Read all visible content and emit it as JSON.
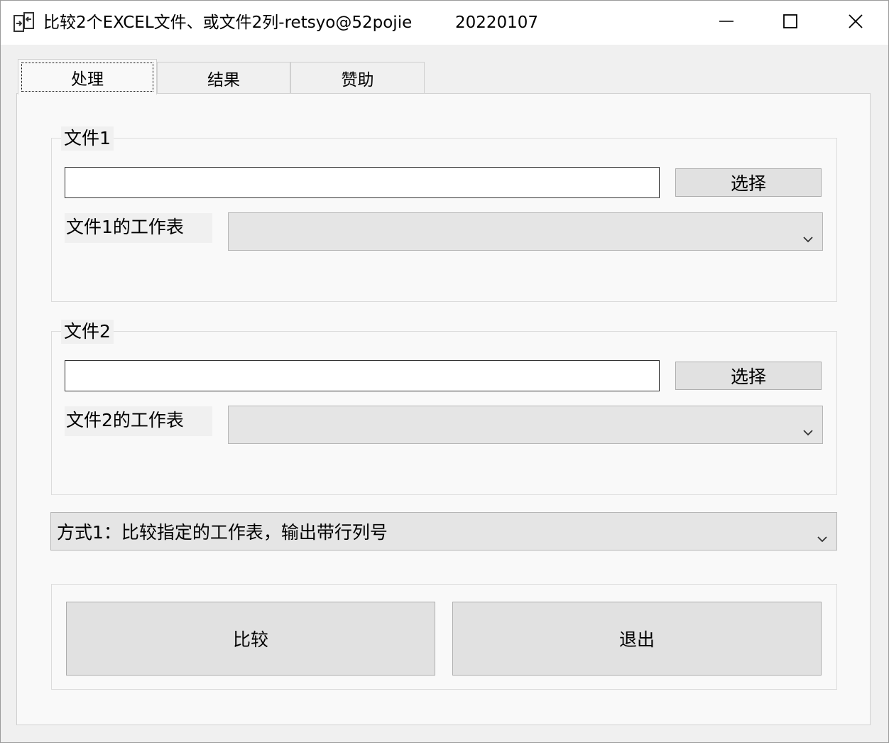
{
  "window": {
    "title": "比较2个EXCEL文件、或文件2列-retsyo@52pojie",
    "version": "20220107"
  },
  "tabs": [
    {
      "label": "处理",
      "active": true
    },
    {
      "label": "结果",
      "active": false
    },
    {
      "label": "赞助",
      "active": false
    }
  ],
  "file1": {
    "legend": "文件1",
    "path_value": "",
    "choose_label": "选择",
    "sheet_label": "文件1的工作表",
    "sheet_selected": ""
  },
  "file2": {
    "legend": "文件2",
    "path_value": "",
    "choose_label": "选择",
    "sheet_label": "文件2的工作表",
    "sheet_selected": ""
  },
  "mode": {
    "selected": "方式1：比较指定的工作表，输出带行列号"
  },
  "actions": {
    "compare_label": "比较",
    "exit_label": "退出"
  },
  "colors": {
    "titlebar": "#ffffff",
    "window_bg": "#f0f0f0",
    "panel_bg": "#f9f9f9",
    "button_bg": "#e1e1e1",
    "combo_bg": "#e5e5e5"
  },
  "icons": {
    "app": "compare-files-icon",
    "minimize": "minimize-icon",
    "maximize": "maximize-icon",
    "close": "close-icon",
    "dropdown": "chevron-down-icon"
  }
}
